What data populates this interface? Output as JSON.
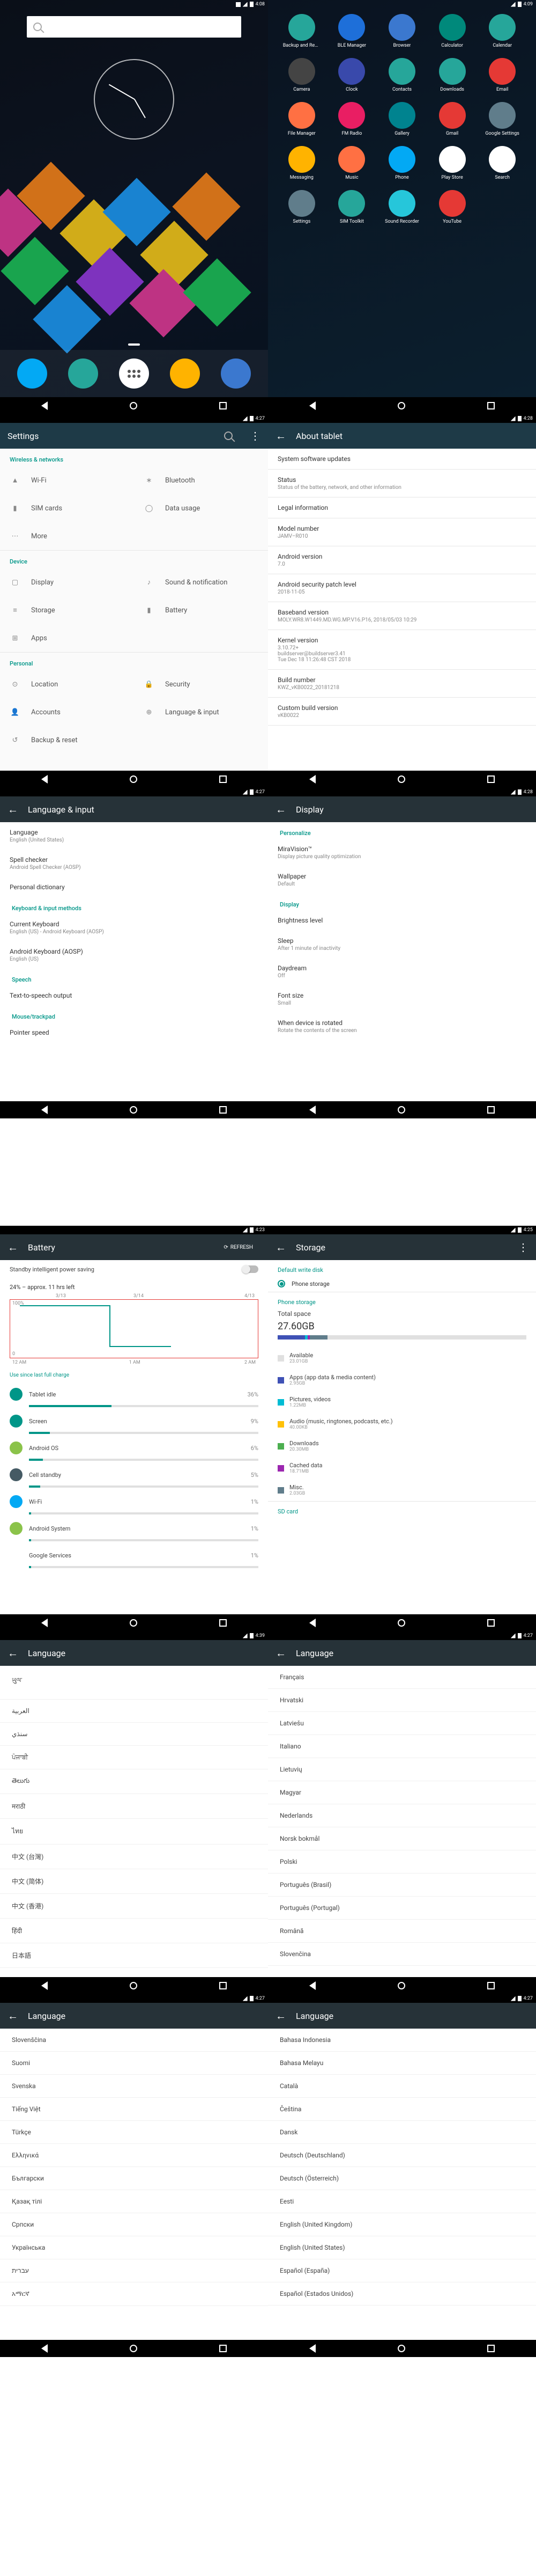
{
  "times": {
    "home1": "4:08",
    "home2": "4:09",
    "settings": "4:27",
    "about": "4:28",
    "lang": "4:27",
    "display": "4:28",
    "battery": "4:23",
    "storage": "4:25",
    "lang_a": "4:39",
    "lang_b": "4:27",
    "lang_c": "4:27",
    "lang_d": "4:27"
  },
  "drawer": {
    "apps": [
      {
        "label": "Backup and Rest…",
        "bg": "#26a69a"
      },
      {
        "label": "BLE Manager",
        "bg": "#1e6fd9"
      },
      {
        "label": "Browser",
        "bg": "#3b78cf"
      },
      {
        "label": "Calculator",
        "bg": "#00897b"
      },
      {
        "label": "Calendar",
        "bg": "#26a69a"
      },
      {
        "label": "Camera",
        "bg": "#444"
      },
      {
        "label": "Clock",
        "bg": "#3949ab"
      },
      {
        "label": "Contacts",
        "bg": "#26a69a"
      },
      {
        "label": "Downloads",
        "bg": "#26a69a"
      },
      {
        "label": "Email",
        "bg": "#e53935"
      },
      {
        "label": "File Manager",
        "bg": "#ff7043"
      },
      {
        "label": "FM Radio",
        "bg": "#e91e63"
      },
      {
        "label": "Gallery",
        "bg": "#00838f"
      },
      {
        "label": "Gmail",
        "bg": "#e53935"
      },
      {
        "label": "Google Settings",
        "bg": "#607d8b"
      },
      {
        "label": "Messaging",
        "bg": "#ffb300"
      },
      {
        "label": "Music",
        "bg": "#ff7043"
      },
      {
        "label": "Phone",
        "bg": "#03a9f4"
      },
      {
        "label": "Play Store",
        "bg": "#fff"
      },
      {
        "label": "Search",
        "bg": "#fff"
      },
      {
        "label": "Settings",
        "bg": "#607d8b"
      },
      {
        "label": "SIM Toolkit",
        "bg": "#26a69a"
      },
      {
        "label": "Sound Recorder",
        "bg": "#26c6da"
      },
      {
        "label": "YouTube",
        "bg": "#e53935"
      }
    ]
  },
  "dock": [
    {
      "name": "phone",
      "bg": "#03a9f4"
    },
    {
      "name": "contacts",
      "bg": "#26a69a"
    },
    {
      "name": "drawer",
      "bg": "#ffffff"
    },
    {
      "name": "messaging",
      "bg": "#ffb300"
    },
    {
      "name": "browser",
      "bg": "#3b78cf"
    }
  ],
  "settings": {
    "title": "Settings",
    "s1": "Wireless & networks",
    "wifi": "Wi-Fi",
    "bt": "Bluetooth",
    "sim": "SIM cards",
    "data": "Data usage",
    "more": "More",
    "s2": "Device",
    "display": "Display",
    "sound": "Sound & notification",
    "storage": "Storage",
    "battery": "Battery",
    "apps": "Apps",
    "s3": "Personal",
    "location": "Location",
    "security": "Security",
    "accounts": "Accounts",
    "lang": "Language & input",
    "backup": "Backup & reset"
  },
  "about": {
    "title": "About tablet",
    "updates": "System software updates",
    "rows": [
      {
        "k": "Status",
        "v": "Status of the battery, network, and other information"
      },
      {
        "k": "Legal information",
        "v": ""
      },
      {
        "k": "Model number",
        "v": "JAMV–R010"
      },
      {
        "k": "Android version",
        "v": "7.0"
      },
      {
        "k": "Android security patch level",
        "v": "2018-11-05"
      },
      {
        "k": "Baseband version",
        "v": "MOLY.WR8.W1449.MD.WG.MP.V16.P16, 2018/05/03 10:29"
      },
      {
        "k": "Kernel version",
        "v": "3.10.72+\nbuildserver@buildserver3.41\nTue Dec 18 11:26:48 CST 2018"
      },
      {
        "k": "Build number",
        "v": "KWZ_vKB0022_20181218"
      },
      {
        "k": "Custom build version",
        "v": "vKB0022"
      }
    ]
  },
  "langinput": {
    "title": "Language & input",
    "rows": [
      {
        "k": "Language",
        "v": "English (United States)"
      },
      {
        "k": "Spell checker",
        "v": "Android Spell Checker (AOSP)"
      },
      {
        "k": "Personal dictionary",
        "v": ""
      }
    ],
    "hdr2": "Keyboard & input methods",
    "rows2": [
      {
        "k": "Current Keyboard",
        "v": "English (US) - Android Keyboard (AOSP)"
      },
      {
        "k": "Android Keyboard (AOSP)",
        "v": "English (US)"
      }
    ],
    "hdr3": "Speech",
    "rows3": [
      {
        "k": "Text-to-speech output",
        "v": ""
      }
    ],
    "hdr4": "Mouse/trackpad",
    "rows4": [
      {
        "k": "Pointer speed",
        "v": ""
      }
    ]
  },
  "displaypane": {
    "title": "Display",
    "hdr1": "Personalize",
    "rows1": [
      {
        "k": "MiraVision™",
        "v": "Display picture quality optimization"
      },
      {
        "k": "Wallpaper",
        "v": "Default"
      }
    ],
    "hdr2": "Display",
    "rows2": [
      {
        "k": "Brightness level",
        "v": ""
      },
      {
        "k": "Sleep",
        "v": "After 1 minute of inactivity"
      },
      {
        "k": "Daydream",
        "v": "Off"
      },
      {
        "k": "Font size",
        "v": "Small"
      },
      {
        "k": "When device is rotated",
        "v": "Rotate the contents of the screen"
      }
    ]
  },
  "battery": {
    "title": "Battery",
    "refresh": "REFRESH",
    "mode": "Standby intelligent power saving",
    "status": "24% – approx. 11 hrs left",
    "dates": [
      "3/13",
      "3/14",
      "4/13"
    ],
    "xaxis": [
      "12 AM",
      "1 AM",
      "2 AM"
    ],
    "since": "Use since last full charge",
    "items": [
      {
        "name": "Tablet idle",
        "pct": "36%",
        "w": 36,
        "bg": "#009688"
      },
      {
        "name": "Screen",
        "pct": "9%",
        "w": 9,
        "bg": "#009688"
      },
      {
        "name": "Android OS",
        "pct": "6%",
        "w": 6,
        "bg": "#8bc34a"
      },
      {
        "name": "Cell standby",
        "pct": "5%",
        "w": 5,
        "bg": "#455a64"
      },
      {
        "name": "Wi-Fi",
        "pct": "1%",
        "w": 1,
        "bg": "#03a9f4"
      },
      {
        "name": "Android System",
        "pct": "1%",
        "w": 1,
        "bg": "#8bc34a"
      },
      {
        "name": "Google Services",
        "pct": "1%",
        "w": 1,
        "bg": "#fff"
      }
    ]
  },
  "storage": {
    "title": "Storage",
    "hdr1": "Default write disk",
    "opt": "Phone storage",
    "hdr2": "Phone storage",
    "total_l": "Total space",
    "total_v": "27.60GB",
    "rows": [
      {
        "chip": "#e0e0e0",
        "k": "Available",
        "v": "23.01GB"
      },
      {
        "chip": "#3f51b5",
        "k": "Apps (app data & media content)",
        "v": "2.95GB"
      },
      {
        "chip": "#00bcd4",
        "k": "Pictures, videos",
        "v": "1.22MB"
      },
      {
        "chip": "#ffc107",
        "k": "Audio (music, ringtones, podcasts, etc.)",
        "v": "40.00KB"
      },
      {
        "chip": "#4caf50",
        "k": "Downloads",
        "v": "20.30MB"
      },
      {
        "chip": "#9c27b0",
        "k": "Cached data",
        "v": "18.71MB"
      },
      {
        "chip": "#607d8b",
        "k": "Misc.",
        "v": "2.03GB"
      }
    ],
    "sd": "SD card"
  },
  "lang_a": [
    "ཡུལ་",
    "العربية",
    "سنڌي",
    "ਪੰਜਾਬੀ",
    "తెలుగు",
    "मराठी",
    "ไทย",
    "中文 (台灣)",
    "中文 (简体)",
    "中文 (香港)",
    "हिंदी",
    "日本語"
  ],
  "lang_b": [
    "Français",
    "Hrvatski",
    "Latviešu",
    "Italiano",
    "Lietuvių",
    "Magyar",
    "Nederlands",
    "Norsk bokmål",
    "Polski",
    "Português (Brasil)",
    "Português (Portugal)",
    "Română",
    "Slovenčina"
  ],
  "lang_c": [
    "Slovenščina",
    "Suomi",
    "Svenska",
    "Tiếng Việt",
    "Türkçe",
    "Ελληνικά",
    "Български",
    "Қазақ тілі",
    "Српски",
    "Українська",
    "עברית",
    "አማርኛ"
  ],
  "lang_d": [
    "Bahasa Indonesia",
    "Bahasa Melayu",
    "Català",
    "Čeština",
    "Dansk",
    "Deutsch (Deutschland)",
    "Deutsch (Österreich)",
    "Eesti",
    "English (United Kingdom)",
    "English (United States)",
    "Español (España)",
    "Español (Estados Unidos)"
  ],
  "lang_title": "Language"
}
